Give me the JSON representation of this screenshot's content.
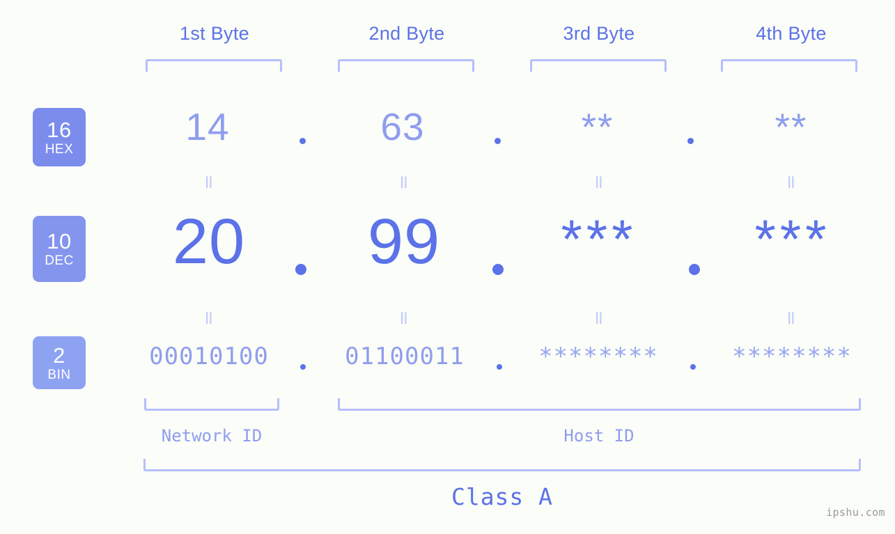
{
  "colors": {
    "background": "#fbfdf8",
    "accent_strong": "#5b72e8",
    "accent_light": "#8f9dee",
    "bracket": "#b5bffc",
    "badge_hex": "#7b8ced",
    "badge_dec": "#8495ee",
    "badge_bin": "#8ea2f2",
    "watermark": "#9a9a9a"
  },
  "byte_headers": [
    {
      "label": "1st Byte"
    },
    {
      "label": "2nd Byte"
    },
    {
      "label": "3rd Byte"
    },
    {
      "label": "4th Byte"
    }
  ],
  "radix_badges": [
    {
      "number": "16",
      "name": "HEX"
    },
    {
      "number": "10",
      "name": "DEC"
    },
    {
      "number": "2",
      "name": "BIN"
    }
  ],
  "rows": {
    "hex": {
      "radix": "16",
      "radix_name": "HEX",
      "values": [
        "14",
        "63",
        "**",
        "**"
      ],
      "separator": "."
    },
    "dec": {
      "radix": "10",
      "radix_name": "DEC",
      "values": [
        "20",
        "99",
        "***",
        "***"
      ],
      "separator": "."
    },
    "bin": {
      "radix": "2",
      "radix_name": "BIN",
      "values": [
        "00010100",
        "01100011",
        "********",
        "********"
      ],
      "separator": "."
    }
  },
  "equals_sign": "=",
  "sections": {
    "network_id": "Network ID",
    "host_id": "Host ID",
    "class": "Class A"
  },
  "watermark": "ipshu.com"
}
